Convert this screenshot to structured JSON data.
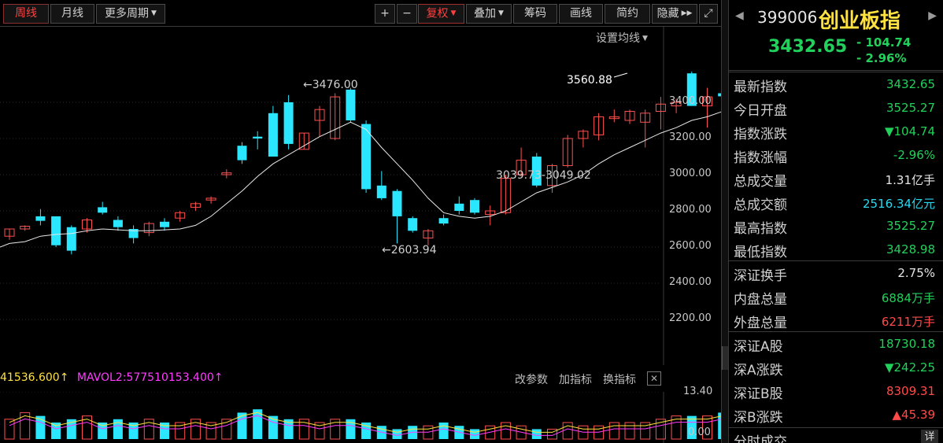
{
  "toolbar": {
    "period_week": "周线",
    "period_month": "月线",
    "more_periods": "更多周期",
    "plus": "+",
    "minus": "−",
    "fuquan": "复权",
    "overlay": "叠加",
    "chips": "筹码",
    "draw": "画线",
    "simple": "简约",
    "hide": "隐藏"
  },
  "chart": {
    "ma_setting": "设置均线",
    "y_labels": [
      "3400.00",
      "3200.00",
      "3000.00",
      "2800.00",
      "2600.00",
      "2400.00",
      "2200.00"
    ],
    "high_annot": "←3476.00",
    "low_annot": "←2603.94",
    "range_annot": "3039.73-3049.02",
    "recent_high_annot": "3560.88",
    "candle_data": [
      [
        2660,
        2700,
        2640,
        2700
      ],
      [
        2700,
        2720,
        2690,
        2715
      ],
      [
        2770,
        2810,
        2720,
        2745
      ],
      [
        2770,
        2770,
        2600,
        2610
      ],
      [
        2710,
        2720,
        2560,
        2580
      ],
      [
        2700,
        2760,
        2680,
        2750
      ],
      [
        2820,
        2850,
        2780,
        2790
      ],
      [
        2750,
        2770,
        2690,
        2710
      ],
      [
        2700,
        2720,
        2620,
        2650
      ],
      [
        2680,
        2740,
        2660,
        2730
      ],
      [
        2740,
        2760,
        2690,
        2710
      ],
      [
        2760,
        2800,
        2740,
        2790
      ],
      [
        2820,
        2850,
        2800,
        2840
      ],
      [
        2860,
        2880,
        2840,
        2870
      ],
      [
        3000,
        3030,
        2980,
        3010
      ],
      [
        3160,
        3180,
        3060,
        3080
      ],
      [
        3210,
        3240,
        3140,
        3200
      ],
      [
        3340,
        3380,
        3100,
        3100
      ],
      [
        3400,
        3440,
        3140,
        3170
      ],
      [
        3140,
        3230,
        3140,
        3230
      ],
      [
        3300,
        3380,
        3210,
        3360
      ],
      [
        3200,
        3450,
        3190,
        3430
      ],
      [
        3470,
        3480,
        3290,
        3300
      ],
      [
        3280,
        3300,
        2900,
        2920
      ],
      [
        2940,
        3020,
        2860,
        2870
      ],
      [
        2910,
        2920,
        2620,
        2770
      ],
      [
        2760,
        2770,
        2680,
        2690
      ],
      [
        2650,
        2700,
        2610,
        2690
      ],
      [
        2760,
        2780,
        2720,
        2730
      ],
      [
        2840,
        2880,
        2780,
        2800
      ],
      [
        2860,
        2870,
        2780,
        2790
      ],
      [
        2780,
        2830,
        2720,
        2800
      ],
      [
        2790,
        3000,
        2780,
        2980
      ],
      [
        3000,
        3150,
        2990,
        3080
      ],
      [
        3100,
        3120,
        2930,
        2940
      ],
      [
        2940,
        3060,
        2900,
        3050
      ],
      [
        3050,
        3220,
        3040,
        3200
      ],
      [
        3200,
        3250,
        3150,
        3240
      ],
      [
        3220,
        3340,
        3190,
        3320
      ],
      [
        3310,
        3360,
        3290,
        3320
      ],
      [
        3300,
        3360,
        3280,
        3350
      ],
      [
        3290,
        3360,
        3150,
        3340
      ],
      [
        3350,
        3430,
        3250,
        3390
      ],
      [
        3380,
        3420,
        3340,
        3400
      ],
      [
        3560,
        3570,
        3380,
        3380
      ],
      [
        3380,
        3480,
        3260,
        3430
      ],
      [
        3450,
        3560,
        3420,
        3433
      ]
    ],
    "ma_values": [
      2620,
      2630,
      2660,
      2670,
      2675,
      2690,
      2700,
      2695,
      2690,
      2690,
      2695,
      2700,
      2720,
      2770,
      2840,
      2910,
      2990,
      3060,
      3110,
      3160,
      3210,
      3250,
      3290,
      3250,
      3150,
      3060,
      2970,
      2870,
      2790,
      2770,
      2760,
      2770,
      2800,
      2850,
      2900,
      2930,
      2960,
      3000,
      3060,
      3110,
      3150,
      3190,
      3230,
      3260,
      3300,
      3320,
      3350
    ]
  },
  "volume": {
    "legend_1": "41536.600",
    "legend_2": "MAVOL2:577510153.400",
    "btn_params": "改参数",
    "btn_add": "加指标",
    "btn_change": "换指标",
    "close": "✕",
    "y_top": "13.40",
    "y_bottom": "0.00",
    "vol_data": [
      6,
      8,
      7,
      5,
      6,
      7,
      5,
      6,
      5,
      6,
      5,
      5,
      6,
      5,
      6,
      8,
      9,
      7,
      6,
      6,
      5,
      6,
      6,
      5,
      4,
      3,
      4,
      4,
      5,
      4,
      3,
      4,
      5,
      4,
      3,
      3,
      5,
      4,
      4,
      5,
      5,
      5,
      6,
      7,
      7,
      7,
      8
    ]
  },
  "panel": {
    "code": "399006",
    "name": "创业板指",
    "price": "3432.65",
    "change": "- 104.74",
    "pct": "- 2.96%",
    "rows_a": [
      {
        "k": "最新指数",
        "v": "3432.65",
        "c": "green"
      },
      {
        "k": "今日开盘",
        "v": "3525.27",
        "c": "green"
      },
      {
        "k": "指数涨跌",
        "v": "▼104.74",
        "c": "green"
      },
      {
        "k": "指数涨幅",
        "v": "-2.96%",
        "c": "green"
      },
      {
        "k": "总成交量",
        "v": "1.31亿手",
        "c": "white"
      },
      {
        "k": "总成交额",
        "v": "2516.34亿元",
        "c": "cyan"
      },
      {
        "k": "最高指数",
        "v": "3525.27",
        "c": "green"
      },
      {
        "k": "最低指数",
        "v": "3428.98",
        "c": "green"
      }
    ],
    "rows_b": [
      {
        "k": "深证换手",
        "v": "2.75%",
        "c": "white"
      },
      {
        "k": "内盘总量",
        "v": "6884万手",
        "c": "green"
      },
      {
        "k": "外盘总量",
        "v": "6211万手",
        "c": "red"
      }
    ],
    "rows_c": [
      {
        "k": "深证A股",
        "v": "18730.18",
        "c": "green"
      },
      {
        "k": "深A涨跌",
        "v": "▼242.25",
        "c": "green"
      },
      {
        "k": "深证B股",
        "v": "8309.31",
        "c": "red"
      },
      {
        "k": "深B涨跌",
        "v": "▲45.39",
        "c": "red"
      }
    ],
    "fenshi": "分时成交",
    "fenshi_btn": "详"
  }
}
